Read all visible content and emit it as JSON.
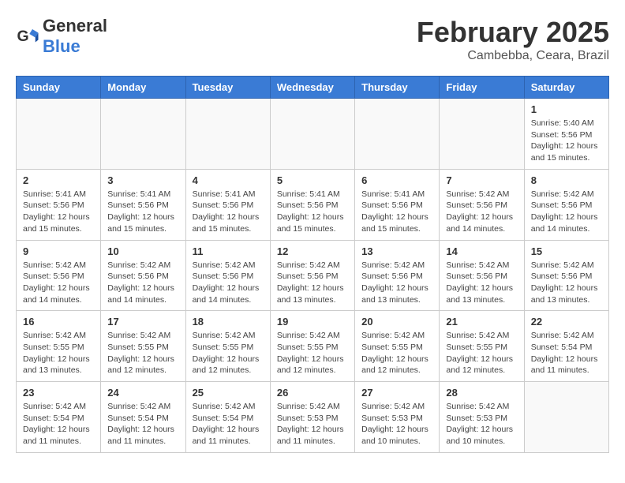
{
  "header": {
    "logo_general": "General",
    "logo_blue": "Blue",
    "month_year": "February 2025",
    "location": "Cambebba, Ceara, Brazil"
  },
  "days_of_week": [
    "Sunday",
    "Monday",
    "Tuesday",
    "Wednesday",
    "Thursday",
    "Friday",
    "Saturday"
  ],
  "weeks": [
    [
      {
        "day": "",
        "info": ""
      },
      {
        "day": "",
        "info": ""
      },
      {
        "day": "",
        "info": ""
      },
      {
        "day": "",
        "info": ""
      },
      {
        "day": "",
        "info": ""
      },
      {
        "day": "",
        "info": ""
      },
      {
        "day": "1",
        "info": "Sunrise: 5:40 AM\nSunset: 5:56 PM\nDaylight: 12 hours and 15 minutes."
      }
    ],
    [
      {
        "day": "2",
        "info": "Sunrise: 5:41 AM\nSunset: 5:56 PM\nDaylight: 12 hours and 15 minutes."
      },
      {
        "day": "3",
        "info": "Sunrise: 5:41 AM\nSunset: 5:56 PM\nDaylight: 12 hours and 15 minutes."
      },
      {
        "day": "4",
        "info": "Sunrise: 5:41 AM\nSunset: 5:56 PM\nDaylight: 12 hours and 15 minutes."
      },
      {
        "day": "5",
        "info": "Sunrise: 5:41 AM\nSunset: 5:56 PM\nDaylight: 12 hours and 15 minutes."
      },
      {
        "day": "6",
        "info": "Sunrise: 5:41 AM\nSunset: 5:56 PM\nDaylight: 12 hours and 15 minutes."
      },
      {
        "day": "7",
        "info": "Sunrise: 5:42 AM\nSunset: 5:56 PM\nDaylight: 12 hours and 14 minutes."
      },
      {
        "day": "8",
        "info": "Sunrise: 5:42 AM\nSunset: 5:56 PM\nDaylight: 12 hours and 14 minutes."
      }
    ],
    [
      {
        "day": "9",
        "info": "Sunrise: 5:42 AM\nSunset: 5:56 PM\nDaylight: 12 hours and 14 minutes."
      },
      {
        "day": "10",
        "info": "Sunrise: 5:42 AM\nSunset: 5:56 PM\nDaylight: 12 hours and 14 minutes."
      },
      {
        "day": "11",
        "info": "Sunrise: 5:42 AM\nSunset: 5:56 PM\nDaylight: 12 hours and 14 minutes."
      },
      {
        "day": "12",
        "info": "Sunrise: 5:42 AM\nSunset: 5:56 PM\nDaylight: 12 hours and 13 minutes."
      },
      {
        "day": "13",
        "info": "Sunrise: 5:42 AM\nSunset: 5:56 PM\nDaylight: 12 hours and 13 minutes."
      },
      {
        "day": "14",
        "info": "Sunrise: 5:42 AM\nSunset: 5:56 PM\nDaylight: 12 hours and 13 minutes."
      },
      {
        "day": "15",
        "info": "Sunrise: 5:42 AM\nSunset: 5:56 PM\nDaylight: 12 hours and 13 minutes."
      }
    ],
    [
      {
        "day": "16",
        "info": "Sunrise: 5:42 AM\nSunset: 5:55 PM\nDaylight: 12 hours and 13 minutes."
      },
      {
        "day": "17",
        "info": "Sunrise: 5:42 AM\nSunset: 5:55 PM\nDaylight: 12 hours and 12 minutes."
      },
      {
        "day": "18",
        "info": "Sunrise: 5:42 AM\nSunset: 5:55 PM\nDaylight: 12 hours and 12 minutes."
      },
      {
        "day": "19",
        "info": "Sunrise: 5:42 AM\nSunset: 5:55 PM\nDaylight: 12 hours and 12 minutes."
      },
      {
        "day": "20",
        "info": "Sunrise: 5:42 AM\nSunset: 5:55 PM\nDaylight: 12 hours and 12 minutes."
      },
      {
        "day": "21",
        "info": "Sunrise: 5:42 AM\nSunset: 5:55 PM\nDaylight: 12 hours and 12 minutes."
      },
      {
        "day": "22",
        "info": "Sunrise: 5:42 AM\nSunset: 5:54 PM\nDaylight: 12 hours and 11 minutes."
      }
    ],
    [
      {
        "day": "23",
        "info": "Sunrise: 5:42 AM\nSunset: 5:54 PM\nDaylight: 12 hours and 11 minutes."
      },
      {
        "day": "24",
        "info": "Sunrise: 5:42 AM\nSunset: 5:54 PM\nDaylight: 12 hours and 11 minutes."
      },
      {
        "day": "25",
        "info": "Sunrise: 5:42 AM\nSunset: 5:54 PM\nDaylight: 12 hours and 11 minutes."
      },
      {
        "day": "26",
        "info": "Sunrise: 5:42 AM\nSunset: 5:53 PM\nDaylight: 12 hours and 11 minutes."
      },
      {
        "day": "27",
        "info": "Sunrise: 5:42 AM\nSunset: 5:53 PM\nDaylight: 12 hours and 10 minutes."
      },
      {
        "day": "28",
        "info": "Sunrise: 5:42 AM\nSunset: 5:53 PM\nDaylight: 12 hours and 10 minutes."
      },
      {
        "day": "",
        "info": ""
      }
    ]
  ]
}
